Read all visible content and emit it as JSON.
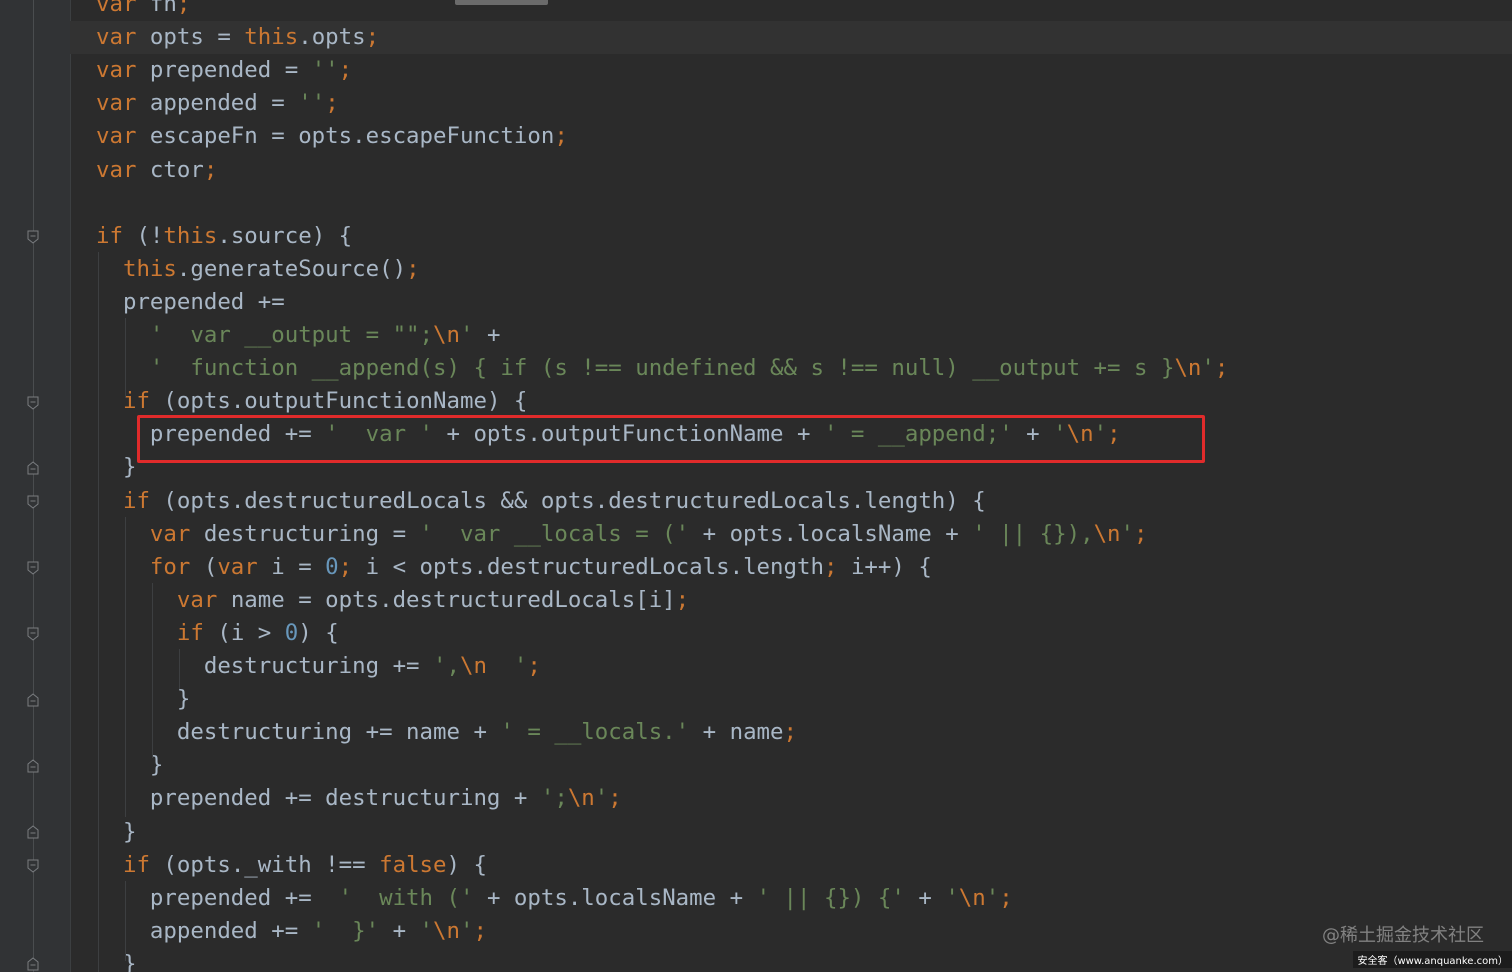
{
  "editor": {
    "theme_colors": {
      "background": "#2b2b2b",
      "keyword": "#cc7832",
      "string": "#6a8759",
      "number": "#6897bb",
      "identifier": "#a9b7c6",
      "highlight_box": "#e02b2b"
    },
    "lines": [
      [
        {
          "t": "var ",
          "c": "kw"
        },
        {
          "t": "fn",
          "c": ""
        },
        {
          "t": ";",
          "c": "punc"
        }
      ],
      [
        {
          "t": "var ",
          "c": "kw"
        },
        {
          "t": "opts = ",
          "c": ""
        },
        {
          "t": "this",
          "c": "kw"
        },
        {
          "t": ".opts",
          "c": ""
        },
        {
          "t": ";",
          "c": "punc"
        }
      ],
      [
        {
          "t": "var ",
          "c": "kw"
        },
        {
          "t": "prepended = ",
          "c": ""
        },
        {
          "t": "''",
          "c": "str"
        },
        {
          "t": ";",
          "c": "punc"
        }
      ],
      [
        {
          "t": "var ",
          "c": "kw"
        },
        {
          "t": "appended = ",
          "c": ""
        },
        {
          "t": "''",
          "c": "str"
        },
        {
          "t": ";",
          "c": "punc"
        }
      ],
      [
        {
          "t": "var ",
          "c": "kw"
        },
        {
          "t": "escapeFn = opts.escapeFunction",
          "c": ""
        },
        {
          "t": ";",
          "c": "punc"
        }
      ],
      [
        {
          "t": "var ",
          "c": "kw"
        },
        {
          "t": "ctor",
          "c": ""
        },
        {
          "t": ";",
          "c": "punc"
        }
      ],
      [],
      [
        {
          "t": "if ",
          "c": "kw"
        },
        {
          "t": "(!",
          "c": ""
        },
        {
          "t": "this",
          "c": "kw"
        },
        {
          "t": ".source) {",
          "c": ""
        }
      ],
      [
        {
          "t": "  ",
          "c": ""
        },
        {
          "t": "this",
          "c": "kw"
        },
        {
          "t": ".generateSource()",
          "c": ""
        },
        {
          "t": ";",
          "c": "punc"
        }
      ],
      [
        {
          "t": "  prepended +=",
          "c": ""
        }
      ],
      [
        {
          "t": "    ",
          "c": ""
        },
        {
          "t": "'  var __output = \"\";",
          "c": "str"
        },
        {
          "t": "\\n",
          "c": "kw"
        },
        {
          "t": "'",
          "c": "str"
        },
        {
          "t": " +",
          "c": ""
        }
      ],
      [
        {
          "t": "    ",
          "c": ""
        },
        {
          "t": "'  function __append(s) { if (s !== undefined && s !== null) __output += s }",
          "c": "str"
        },
        {
          "t": "\\n",
          "c": "kw"
        },
        {
          "t": "'",
          "c": "str"
        },
        {
          "t": ";",
          "c": "punc"
        }
      ],
      [
        {
          "t": "  ",
          "c": ""
        },
        {
          "t": "if ",
          "c": "kw"
        },
        {
          "t": "(opts.outputFunctionName) {",
          "c": ""
        }
      ],
      [
        {
          "t": "    prepended += ",
          "c": ""
        },
        {
          "t": "'  var '",
          "c": "str"
        },
        {
          "t": " + opts.outputFunctionName + ",
          "c": ""
        },
        {
          "t": "' = __append;'",
          "c": "str"
        },
        {
          "t": " + ",
          "c": ""
        },
        {
          "t": "'",
          "c": "str"
        },
        {
          "t": "\\n",
          "c": "kw"
        },
        {
          "t": "'",
          "c": "str"
        },
        {
          "t": ";",
          "c": "punc"
        }
      ],
      [
        {
          "t": "  }",
          "c": ""
        }
      ],
      [
        {
          "t": "  ",
          "c": ""
        },
        {
          "t": "if ",
          "c": "kw"
        },
        {
          "t": "(opts.destructuredLocals && opts.destructuredLocals.length) {",
          "c": ""
        }
      ],
      [
        {
          "t": "    ",
          "c": ""
        },
        {
          "t": "var ",
          "c": "kw"
        },
        {
          "t": "destructuring = ",
          "c": ""
        },
        {
          "t": "'  var __locals = ('",
          "c": "str"
        },
        {
          "t": " + opts.localsName + ",
          "c": ""
        },
        {
          "t": "' || {}),",
          "c": "str"
        },
        {
          "t": "\\n",
          "c": "kw"
        },
        {
          "t": "'",
          "c": "str"
        },
        {
          "t": ";",
          "c": "punc"
        }
      ],
      [
        {
          "t": "    ",
          "c": ""
        },
        {
          "t": "for ",
          "c": "kw"
        },
        {
          "t": "(",
          "c": ""
        },
        {
          "t": "var ",
          "c": "kw"
        },
        {
          "t": "i = ",
          "c": ""
        },
        {
          "t": "0",
          "c": "num"
        },
        {
          "t": "; ",
          "c": "punc"
        },
        {
          "t": "i < opts.destructuredLocals.length",
          "c": ""
        },
        {
          "t": "; ",
          "c": "punc"
        },
        {
          "t": "i++) {",
          "c": ""
        }
      ],
      [
        {
          "t": "      ",
          "c": ""
        },
        {
          "t": "var ",
          "c": "kw"
        },
        {
          "t": "name = opts.destructuredLocals[i]",
          "c": ""
        },
        {
          "t": ";",
          "c": "punc"
        }
      ],
      [
        {
          "t": "      ",
          "c": ""
        },
        {
          "t": "if ",
          "c": "kw"
        },
        {
          "t": "(i > ",
          "c": ""
        },
        {
          "t": "0",
          "c": "num"
        },
        {
          "t": ") {",
          "c": ""
        }
      ],
      [
        {
          "t": "        destructuring += ",
          "c": ""
        },
        {
          "t": "',",
          "c": "str"
        },
        {
          "t": "\\n",
          "c": "kw"
        },
        {
          "t": "  '",
          "c": "str"
        },
        {
          "t": ";",
          "c": "punc"
        }
      ],
      [
        {
          "t": "      }",
          "c": ""
        }
      ],
      [
        {
          "t": "      destructuring += name + ",
          "c": ""
        },
        {
          "t": "' = __locals.'",
          "c": "str"
        },
        {
          "t": " + name",
          "c": ""
        },
        {
          "t": ";",
          "c": "punc"
        }
      ],
      [
        {
          "t": "    }",
          "c": ""
        }
      ],
      [
        {
          "t": "    prepended += destructuring + ",
          "c": ""
        },
        {
          "t": "';",
          "c": "str"
        },
        {
          "t": "\\n",
          "c": "kw"
        },
        {
          "t": "'",
          "c": "str"
        },
        {
          "t": ";",
          "c": "punc"
        }
      ],
      [
        {
          "t": "  }",
          "c": ""
        }
      ],
      [
        {
          "t": "  ",
          "c": ""
        },
        {
          "t": "if ",
          "c": "kw"
        },
        {
          "t": "(opts._with !== ",
          "c": ""
        },
        {
          "t": "false",
          "c": "kw"
        },
        {
          "t": ") {",
          "c": ""
        }
      ],
      [
        {
          "t": "    prepended +=  ",
          "c": ""
        },
        {
          "t": "'  with ('",
          "c": "str"
        },
        {
          "t": " + opts.localsName + ",
          "c": ""
        },
        {
          "t": "' || {}) {'",
          "c": "str"
        },
        {
          "t": " + ",
          "c": ""
        },
        {
          "t": "'",
          "c": "str"
        },
        {
          "t": "\\n",
          "c": "kw"
        },
        {
          "t": "'",
          "c": "str"
        },
        {
          "t": ";",
          "c": "punc"
        }
      ],
      [
        {
          "t": "    appended += ",
          "c": ""
        },
        {
          "t": "'  }'",
          "c": "str"
        },
        {
          "t": " + ",
          "c": ""
        },
        {
          "t": "'",
          "c": "str"
        },
        {
          "t": "\\n",
          "c": "kw"
        },
        {
          "t": "'",
          "c": "str"
        },
        {
          "t": ";",
          "c": "punc"
        }
      ],
      [
        {
          "t": "  }",
          "c": ""
        }
      ]
    ]
  },
  "watermark": {
    "main": "@稀土掘金技术社区",
    "sub": "安全客（www.anquanke.com）"
  }
}
